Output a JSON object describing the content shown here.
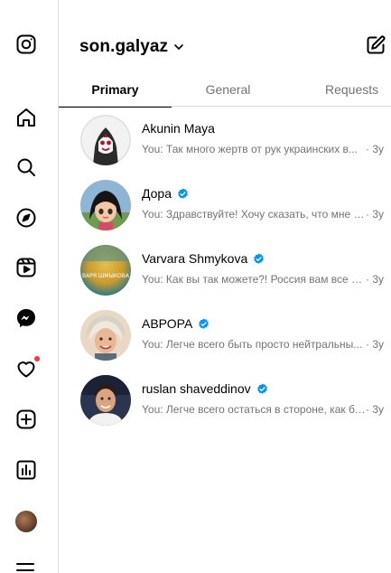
{
  "sidebar": {
    "icons": [
      "instagram-logo-icon",
      "home-icon",
      "search-icon",
      "explore-compass-icon",
      "reels-icon",
      "messenger-icon",
      "heart-notifications-icon",
      "create-plus-icon",
      "dashboard-icon",
      "profile-avatar",
      "menu-icon"
    ],
    "notification_dot_color": "#ff3040"
  },
  "header": {
    "account_name": "son.galyaz"
  },
  "tabs": [
    {
      "label": "Primary",
      "active": true
    },
    {
      "label": "General",
      "active": false
    },
    {
      "label": "Requests",
      "active": false
    }
  ],
  "conversations": [
    {
      "name": "Akunin Maya",
      "verified": false,
      "preview": "You: Так много жертв от рук украинских в...",
      "time": "· 3y"
    },
    {
      "name": "Дора",
      "verified": true,
      "preview": "You: Здравствуйте! Хочу сказать, что мне ж...",
      "time": "· 3y"
    },
    {
      "name": "Varvara Shmykova",
      "verified": true,
      "preview": "You: Как вы так можете?! Россия вам все д...",
      "time": "· 3y",
      "avatar_text": "ВАРЯ ШМЫКОВА"
    },
    {
      "name": "АВРОРА",
      "verified": true,
      "preview": "You: Легче всего быть просто нейтральны...",
      "time": "· 3y"
    },
    {
      "name": "ruslan shaveddinov",
      "verified": true,
      "preview": "You: Легче всего остаться в стороне, как бу...",
      "time": "· 3y"
    }
  ],
  "colors": {
    "verified_badge": "#0095f6",
    "secondary_text": "#737373",
    "divider": "#dbdbdb"
  }
}
